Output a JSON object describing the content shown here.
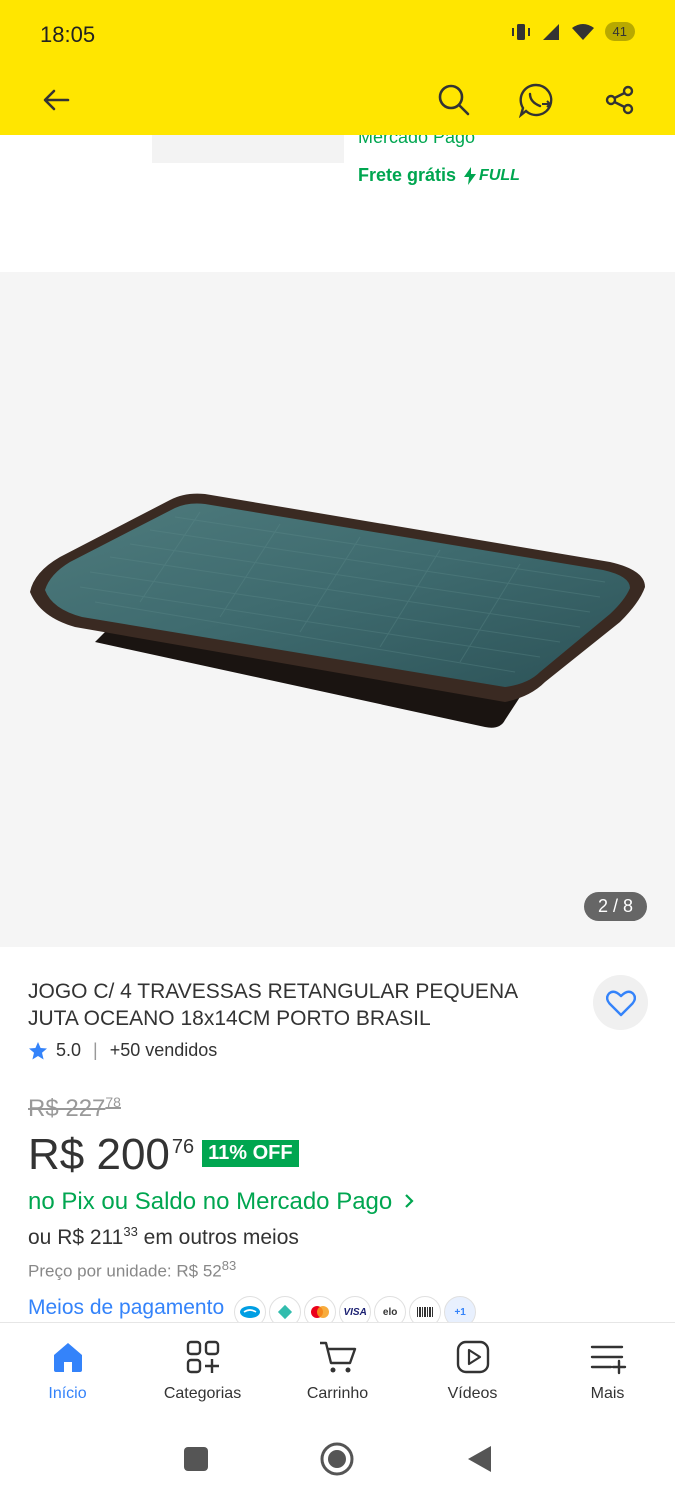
{
  "status_bar": {
    "time": "18:05",
    "battery": "41"
  },
  "top_fragment": {
    "mercado_pago": "Mercado Pago",
    "frete": "Frete grátis",
    "full": "FULL"
  },
  "gallery": {
    "counter": "2 / 8"
  },
  "product": {
    "title": "JOGO C/ 4 TRAVESSAS RETANGULAR PEQUENA JUTA OCEANO 18x14CM PORTO BRASIL",
    "rating": "5.0",
    "sold": "+50 vendidos",
    "old_price_main": "R$ 227",
    "old_price_cents": "78",
    "price_main": "R$ 200",
    "price_cents": "76",
    "discount": "11% OFF",
    "pix_text": "no Pix ou Saldo no Mercado Pago",
    "other_prefix": "ou R$ 211",
    "other_cents": "33",
    "other_suffix": " em outros meios",
    "unit_price_main": "Preço por unidade: R$ 52",
    "unit_price_cents": "83",
    "payment_link": "Meios de pagamento",
    "payment_more": "+1"
  },
  "bottom_nav": [
    {
      "label": "Início",
      "icon": "home-icon",
      "active": true
    },
    {
      "label": "Categorias",
      "icon": "categories-icon"
    },
    {
      "label": "Carrinho",
      "icon": "cart-icon"
    },
    {
      "label": "Vídeos",
      "icon": "video-icon"
    },
    {
      "label": "Mais",
      "icon": "menu-plus-icon"
    }
  ],
  "colors": {
    "header": "#ffe600",
    "green": "#00a650",
    "blue": "#3483fa"
  }
}
